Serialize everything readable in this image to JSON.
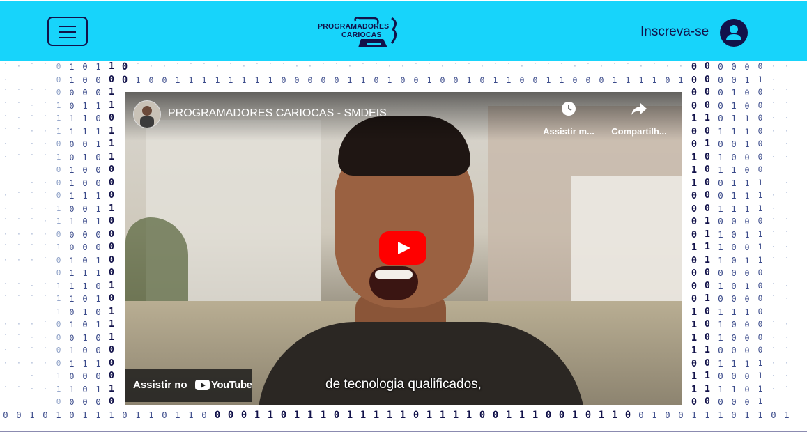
{
  "header": {
    "menu_icon": "hamburger-icon",
    "logo": {
      "line1": "PROGRAMADORES",
      "line2": "CARIOCAS"
    },
    "subscribe_label": "Inscreva-se",
    "user_icon": "user-icon"
  },
  "video": {
    "title": "PROGRAMADORES CARIOCAS - SMDEIS",
    "watch_later_label": "Assistir m...",
    "share_label": "Compartilh...",
    "watch_on_label": "Assistir no",
    "youtube_label": "YouTube",
    "caption": "de tecnologia qualificados,",
    "play_icon": "play-icon"
  },
  "colors": {
    "header_bg": "#17d4fb",
    "navy": "#12124a",
    "play_red": "#ff0000"
  }
}
